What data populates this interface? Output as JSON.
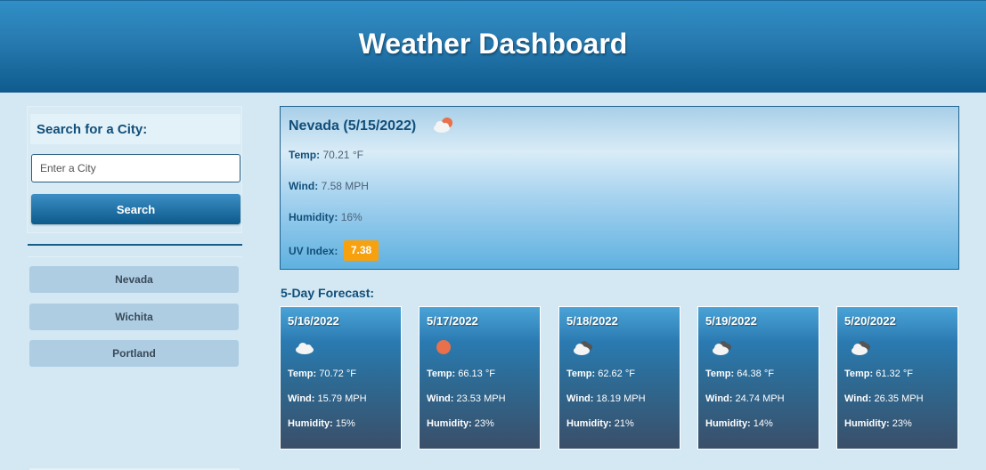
{
  "header": {
    "title": "Weather Dashboard"
  },
  "search": {
    "title": "Search for a City:",
    "placeholder": "Enter a City",
    "button_label": "Search"
  },
  "history": [
    "Nevada",
    "Wichita",
    "Portland"
  ],
  "current": {
    "title": "Nevada (5/15/2022)",
    "icon": "partly-sunny-cloud-icon",
    "temp_label": "Temp:",
    "temp": "70.21 °F",
    "wind_label": "Wind:",
    "wind": "7.58 MPH",
    "humidity_label": "Humidity:",
    "humidity": "16%",
    "uv_label": "UV Index:",
    "uv": "7.38",
    "uv_color": "#f8a10f"
  },
  "forecast": {
    "title": "5-Day Forecast:",
    "days": [
      {
        "date": "5/16/2022",
        "icon": "cloud-icon",
        "temp": "70.72 °F",
        "wind": "15.79 MPH",
        "humidity": "15%"
      },
      {
        "date": "5/17/2022",
        "icon": "sun-icon",
        "temp": "66.13 °F",
        "wind": "23.53 MPH",
        "humidity": "23%"
      },
      {
        "date": "5/18/2022",
        "icon": "dark-cloud-icon",
        "temp": "62.62 °F",
        "wind": "18.19 MPH",
        "humidity": "21%"
      },
      {
        "date": "5/19/2022",
        "icon": "dark-cloud-icon",
        "temp": "64.38 °F",
        "wind": "24.74 MPH",
        "humidity": "14%"
      },
      {
        "date": "5/20/2022",
        "icon": "dark-cloud-icon",
        "temp": "61.32 °F",
        "wind": "26.35 MPH",
        "humidity": "23%"
      }
    ],
    "labels": {
      "temp": "Temp:",
      "wind": "Wind:",
      "humidity": "Humidity:"
    }
  }
}
